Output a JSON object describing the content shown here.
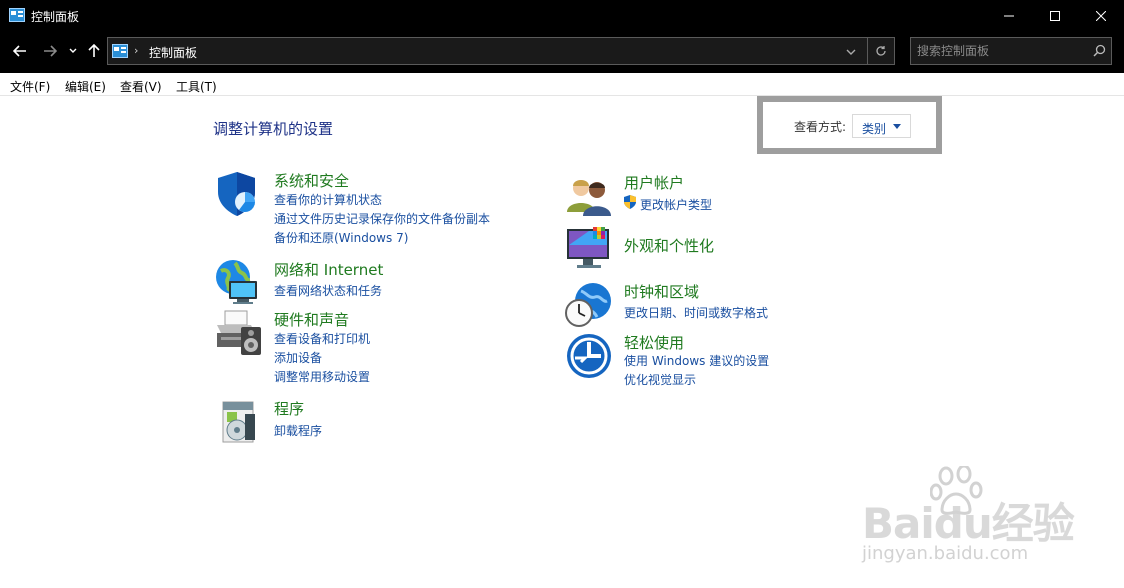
{
  "window": {
    "title": "控制面板"
  },
  "nav": {
    "breadcrumb": "控制面板",
    "search_placeholder": "搜索控制面板"
  },
  "menu": [
    "文件(F)",
    "编辑(E)",
    "查看(V)",
    "工具(T)"
  ],
  "main": {
    "heading": "调整计算机的设置",
    "view_by_label": "查看方式:",
    "view_by_value": "类别"
  },
  "left_categories": [
    {
      "title": "系统和安全",
      "icon": "shield-icon",
      "links": [
        "查看你的计算机状态",
        "通过文件历史记录保存你的文件备份副本",
        "备份和还原(Windows 7)"
      ]
    },
    {
      "title": "网络和 Internet",
      "icon": "network-icon",
      "links": [
        "查看网络状态和任务"
      ]
    },
    {
      "title": "硬件和声音",
      "icon": "printer-icon",
      "links": [
        "查看设备和打印机",
        "添加设备",
        "调整常用移动设置"
      ]
    },
    {
      "title": "程序",
      "icon": "programs-icon",
      "links": [
        "卸载程序"
      ]
    }
  ],
  "right_categories": [
    {
      "title": "用户帐户",
      "icon": "users-icon",
      "links": [
        "更改帐户类型"
      ]
    },
    {
      "title": "外观和个性化",
      "icon": "monitor-icon",
      "links": []
    },
    {
      "title": "时钟和区域",
      "icon": "clock-globe-icon",
      "links": [
        "更改日期、时间或数字格式"
      ]
    },
    {
      "title": "轻松使用",
      "icon": "ease-of-access-icon",
      "links": [
        "使用 Windows 建议的设置",
        "优化视觉显示"
      ]
    }
  ],
  "watermark": {
    "logo": "Baidu经验",
    "url": "jingyan.baidu.com"
  },
  "colors": {
    "titlebar": "#000000",
    "heading": "#1e3287",
    "category_title": "#1f7a1f",
    "link": "#1a4fa0"
  }
}
